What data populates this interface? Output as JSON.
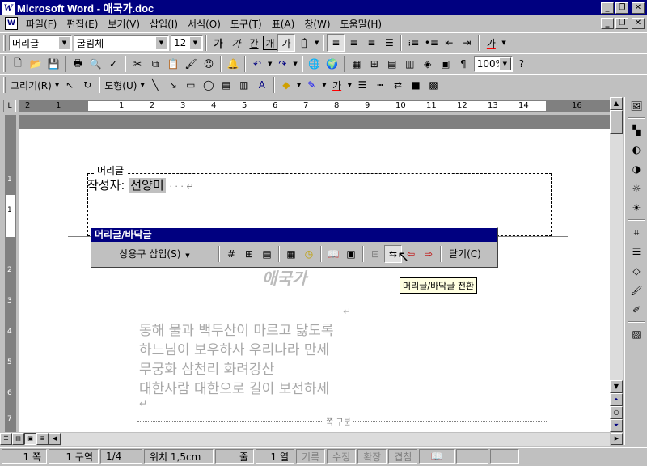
{
  "window": {
    "title": "Microsoft Word - 애국가.doc",
    "app_icon": "W",
    "controls": [
      "_",
      "❐",
      "✕"
    ]
  },
  "menu": {
    "items": [
      "파일(F)",
      "편집(E)",
      "보기(V)",
      "삽입(I)",
      "서식(O)",
      "도구(T)",
      "표(A)",
      "창(W)",
      "도움말(H)"
    ],
    "doc_controls": [
      "_",
      "❐",
      "✕"
    ]
  },
  "formatting": {
    "style": "머리글",
    "font": "굴림체",
    "size": "12",
    "bold": "가",
    "italic": "가",
    "underline": "간",
    "outline": "개",
    "emboss": "가",
    "char_border": "가"
  },
  "standard": {
    "zoom": "100%"
  },
  "drawing": {
    "draw_menu": "그리기(R)",
    "autoshape_menu": "도형(U)",
    "font_color_label": "가"
  },
  "ruler": {
    "numbers": [
      "2",
      "1",
      "1",
      "2",
      "3",
      "4",
      "5",
      "6",
      "7",
      "8",
      "9",
      "10",
      "11",
      "12",
      "13",
      "14",
      "16"
    ],
    "vnumbers": [
      "1",
      "1",
      "2",
      "3",
      "4",
      "5",
      "6",
      "7",
      "8"
    ]
  },
  "document": {
    "header_label": "머리글",
    "author_prefix": "작성자:",
    "author_name": "선양미",
    "faded_title": "애국가",
    "lines": [
      "동해 물과 백두산이 마르고 닳도록",
      "하느님이 보우하사 우리나라 만세",
      "무궁화 삼천리 화려강산",
      "대한사람 대한으로 길이 보전하세"
    ],
    "page_break_label": "쪽 구분"
  },
  "hf_toolbar": {
    "title": "머리글/바닥글",
    "insert_autotext": "상용구 삽입(S)",
    "close": "닫기(C)",
    "tooltip": "머리글/바닥글 전환"
  },
  "status": {
    "page": "1 쪽",
    "section": "1 구역",
    "pages": "1/4",
    "position": "위치 1,5cm",
    "line": "줄",
    "col": "1 열",
    "rec": "기록",
    "trk": "수정",
    "ext": "확장",
    "ovr": "겹침"
  }
}
